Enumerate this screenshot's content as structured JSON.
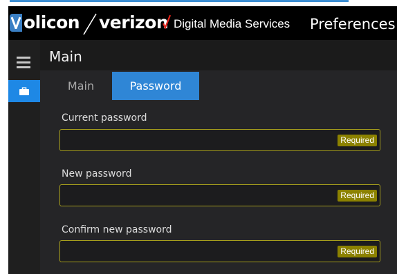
{
  "header": {
    "logo_text": "olicon",
    "brand_text": "verizon",
    "service_name": "Digital Media Services",
    "page_title": "Preferences"
  },
  "main": {
    "title": "Main",
    "tabs": [
      {
        "label": "Main",
        "active": false
      },
      {
        "label": "Password",
        "active": true
      }
    ]
  },
  "form": {
    "fields": [
      {
        "label": "Current password",
        "value": "",
        "badge": "Required"
      },
      {
        "label": "New password",
        "value": "",
        "badge": "Required"
      },
      {
        "label": "Confirm new password",
        "value": "",
        "badge": "Required"
      }
    ]
  },
  "icons": {
    "menu": "hamburger-menu-icon",
    "briefcase": "briefcase-icon",
    "brand_check": "verizon-check-icon"
  },
  "colors": {
    "accent_blue": "#2f86d6",
    "required_border": "#a79f1c",
    "required_badge": "#8c8200",
    "verizon_red": "#e2231a"
  }
}
